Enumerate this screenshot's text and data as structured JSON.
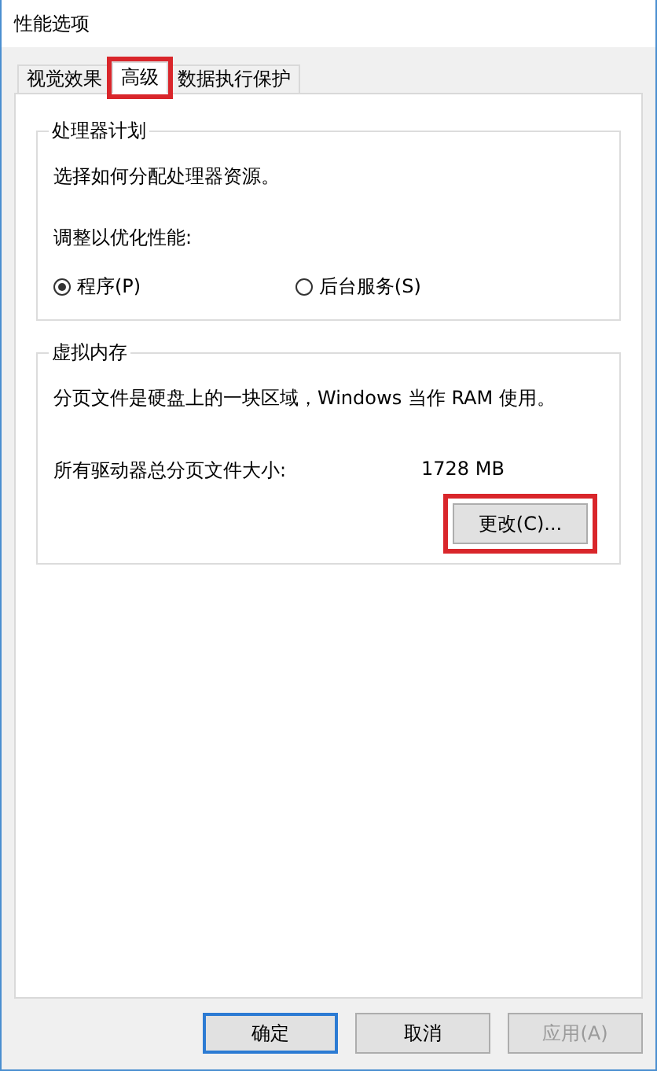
{
  "window": {
    "title": "性能选项"
  },
  "tabs": [
    {
      "label": "视觉效果",
      "selected": false,
      "highlighted": false
    },
    {
      "label": "高级",
      "selected": true,
      "highlighted": true
    },
    {
      "label": "数据执行保护",
      "selected": false,
      "highlighted": false
    }
  ],
  "processor_group": {
    "title": "处理器计划",
    "description": "选择如何分配处理器资源。",
    "adjust_label": "调整以优化性能:",
    "options": [
      {
        "label": "程序(P)",
        "selected": true
      },
      {
        "label": "后台服务(S)",
        "selected": false
      }
    ]
  },
  "virtual_memory_group": {
    "title": "虚拟内存",
    "description": "分页文件是硬盘上的一块区域，Windows 当作 RAM 使用。",
    "size_label": "所有驱动器总分页文件大小:",
    "size_value": "1728 MB",
    "change_button": {
      "label": "更改(C)...",
      "highlighted": true
    }
  },
  "buttons": [
    {
      "label": "确定",
      "default": true,
      "disabled": false
    },
    {
      "label": "取消",
      "default": false,
      "disabled": false
    },
    {
      "label": "应用(A)",
      "default": false,
      "disabled": true
    }
  ]
}
